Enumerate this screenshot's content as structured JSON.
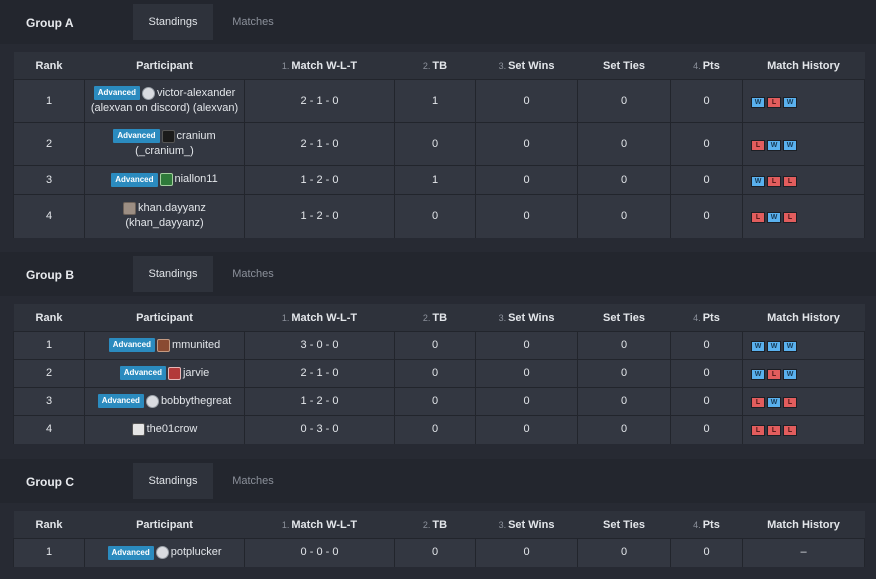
{
  "columns": {
    "rank": "Rank",
    "participant": "Participant",
    "match_num": "1.",
    "match": "Match W-L-T",
    "tb_num": "2.",
    "tb": "TB",
    "set_wins_num": "3.",
    "set_wins": "Set Wins",
    "set_ties": "Set Ties",
    "pts_num": "4.",
    "pts": "Pts",
    "history": "Match History"
  },
  "tabs": {
    "standings": "Standings",
    "matches": "Matches"
  },
  "badge_label": "Advanced",
  "groups": [
    {
      "title": "Group A",
      "rows": [
        {
          "rank": "1",
          "line1": "victor-alexander",
          "line2": "(alexvan on discord) (alexvan)",
          "advanced": true,
          "avatar": "discord-avatar-icon",
          "wlt": "2 - 1 - 0",
          "tb": "1",
          "set_wins": "0",
          "set_ties": "0",
          "pts": "0",
          "history": [
            "W",
            "L",
            "W"
          ]
        },
        {
          "rank": "2",
          "line1": "cranium",
          "line2": "(_cranium_)",
          "advanced": true,
          "avatar": "skull-avatar-icon",
          "wlt": "2 - 1 - 0",
          "tb": "0",
          "set_wins": "0",
          "set_ties": "0",
          "pts": "0",
          "history": [
            "L",
            "W",
            "W"
          ]
        },
        {
          "rank": "3",
          "line1": "niallon11",
          "line2": "",
          "advanced": true,
          "avatar": "green-avatar-icon",
          "wlt": "1 - 2 - 0",
          "tb": "1",
          "set_wins": "0",
          "set_ties": "0",
          "pts": "0",
          "history": [
            "W",
            "L",
            "L"
          ]
        },
        {
          "rank": "4",
          "line1": "khan.dayyanz",
          "line2": "(khan_dayyanz)",
          "advanced": false,
          "avatar": "photo-avatar-icon",
          "wlt": "1 - 2 - 0",
          "tb": "0",
          "set_wins": "0",
          "set_ties": "0",
          "pts": "0",
          "history": [
            "L",
            "W",
            "L"
          ]
        }
      ]
    },
    {
      "title": "Group B",
      "rows": [
        {
          "rank": "1",
          "line1": "mmunited",
          "line2": "",
          "advanced": true,
          "avatar": "brown-avatar-icon",
          "wlt": "3 - 0 - 0",
          "tb": "0",
          "set_wins": "0",
          "set_ties": "0",
          "pts": "0",
          "history": [
            "W",
            "W",
            "W"
          ]
        },
        {
          "rank": "2",
          "line1": "jarvie",
          "line2": "",
          "advanced": true,
          "avatar": "red-avatar-icon",
          "wlt": "2 - 1 - 0",
          "tb": "0",
          "set_wins": "0",
          "set_ties": "0",
          "pts": "0",
          "history": [
            "W",
            "L",
            "W"
          ]
        },
        {
          "rank": "3",
          "line1": "bobbythegreat",
          "line2": "",
          "advanced": true,
          "avatar": "discord-avatar-icon",
          "wlt": "1 - 2 - 0",
          "tb": "0",
          "set_wins": "0",
          "set_ties": "0",
          "pts": "0",
          "history": [
            "L",
            "W",
            "L"
          ]
        },
        {
          "rank": "4",
          "line1": "the01crow",
          "line2": "",
          "advanced": false,
          "avatar": "crow-avatar-icon",
          "wlt": "0 - 3 - 0",
          "tb": "0",
          "set_wins": "0",
          "set_ties": "0",
          "pts": "0",
          "history": [
            "L",
            "L",
            "L"
          ]
        }
      ]
    },
    {
      "title": "Group C",
      "rows": [
        {
          "rank": "1",
          "line1": "potplucker",
          "line2": "",
          "advanced": true,
          "avatar": "discord-avatar-icon",
          "wlt": "0 - 0 - 0",
          "tb": "0",
          "set_wins": "0",
          "set_ties": "0",
          "pts": "0",
          "history": [],
          "history_text": "–"
        }
      ]
    }
  ]
}
